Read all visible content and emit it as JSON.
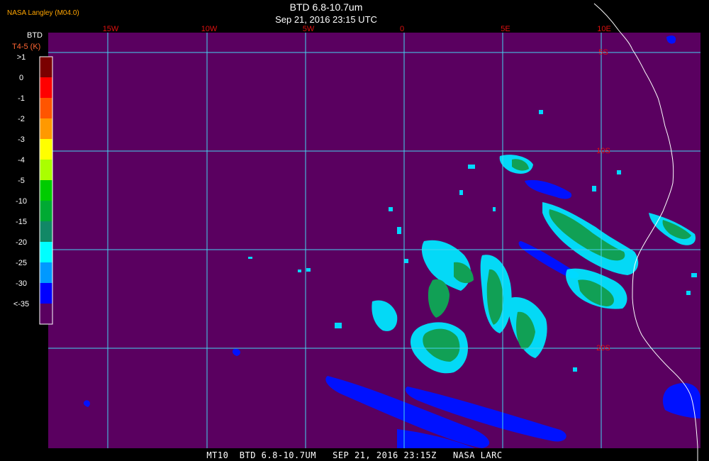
{
  "header": {
    "credit": "NASA Langley (M04.0)",
    "title": "BTD 6.8-10.7um",
    "datetime": "Sep 21, 2016 23:15 UTC"
  },
  "legend": {
    "title": "BTD",
    "subtitle": "T4-5 (K)",
    "ticks": [
      ">1",
      "0",
      "-1",
      "-2",
      "-3",
      "-4",
      "-5",
      "-10",
      "-15",
      "-20",
      "-25",
      "-30",
      "<-35"
    ],
    "colors": [
      "#7a0000",
      "#ff0000",
      "#ff5500",
      "#ff9900",
      "#ffff00",
      "#aaff00",
      "#00cc00",
      "#00aa33",
      "#118866",
      "#00ffff",
      "#0099ff",
      "#0000ff",
      "#5a0060"
    ]
  },
  "map": {
    "background_color": "#5a0060",
    "gridline_color": "#44d6f0",
    "longitude_labels": [
      "15W",
      "10W",
      "5W",
      "0",
      "5E",
      "10E"
    ],
    "latitude_labels": [
      "5S",
      "10S",
      "20S"
    ],
    "label_color": "#e01010",
    "coastline_color": "#ffffff"
  },
  "footer": {
    "text": "MT10  BTD 6.8-10.7UM   SEP 21, 2016 23:15Z   NASA LARC"
  }
}
